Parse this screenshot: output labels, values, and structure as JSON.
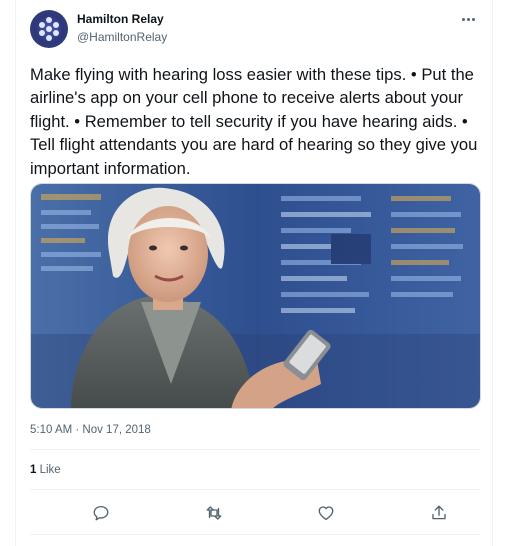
{
  "author": {
    "display_name": "Hamilton Relay",
    "handle": "@HamiltonRelay"
  },
  "tweet": {
    "text": "Make flying with hearing loss easier with these tips. • Put the airline's app on your cell phone to receive alerts about your flight. • Remember to tell security if you have hearing aids. • Tell flight attendants you are hard of hearing so they give you important information.",
    "timestamp": "5:10 AM · Nov 17, 2018"
  },
  "stats": {
    "likes_count": "1",
    "likes_label": "Like"
  },
  "icons": {
    "more": "more-icon",
    "reply": "reply-icon",
    "retweet": "retweet-icon",
    "like": "like-icon",
    "share": "share-icon"
  },
  "colors": {
    "text_primary": "#0f1419",
    "text_secondary": "#536471",
    "divider": "#eff3f4"
  }
}
